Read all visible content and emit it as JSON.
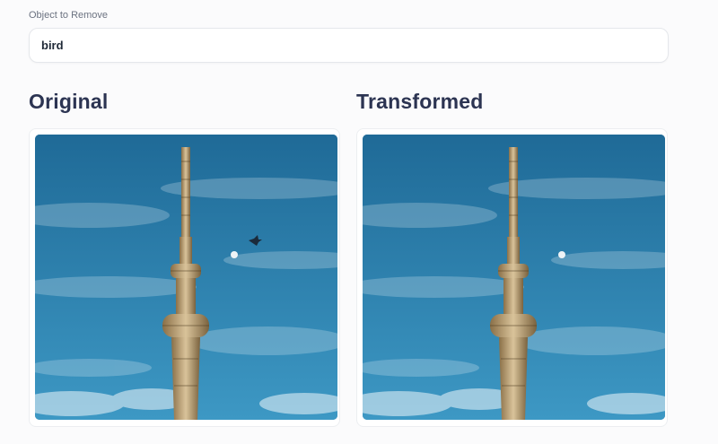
{
  "form": {
    "object_label": "Object to Remove",
    "object_value": "bird"
  },
  "panels": {
    "original": {
      "title": "Original"
    },
    "transformed": {
      "title": "Transformed"
    }
  },
  "photo": {
    "icon": "tower-photo",
    "sky_top": "#1f6a97",
    "sky_bottom": "#3d98c4",
    "tower_color": "#b89a6a"
  }
}
